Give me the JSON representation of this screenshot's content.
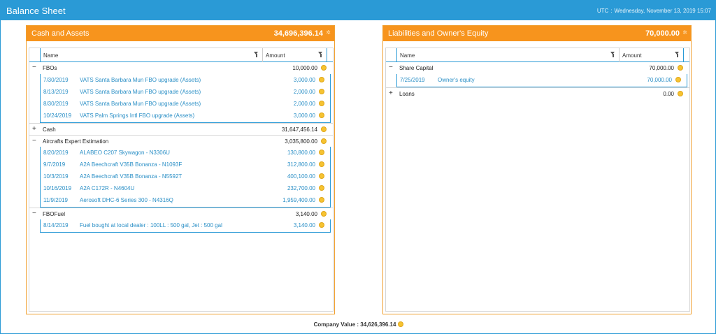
{
  "window": {
    "title": "Balance Sheet",
    "utc_label": "UTC",
    "utc_sep": ":",
    "datetime": "Wednesday, November 13, 2019 15:07"
  },
  "colors": {
    "titlebar": "#2a9ad6",
    "panel_header": "#f7941d",
    "link": "#2a8fc6",
    "coin": "#f6c331"
  },
  "left_panel": {
    "title": "Cash and Assets",
    "total": "34,696,396.14",
    "icon": "settings-icon",
    "columns": {
      "name": "Name",
      "amount": "Amount"
    },
    "groups": [
      {
        "expander": "−",
        "name": "FBOs",
        "amount": "10,000.00",
        "items": [
          {
            "date": "7/30/2019",
            "desc": "VATS Santa Barbara Mun FBO upgrade (Assets)",
            "amount": "3,000.00"
          },
          {
            "date": "8/13/2019",
            "desc": "VATS Santa Barbara Mun FBO upgrade (Assets)",
            "amount": "2,000.00"
          },
          {
            "date": "8/30/2019",
            "desc": "VATS Santa Barbara Mun FBO upgrade (Assets)",
            "amount": "2,000.00"
          },
          {
            "date": "10/24/2019",
            "desc": "VATS Palm Springs Intl FBO upgrade (Assets)",
            "amount": "3,000.00"
          }
        ]
      },
      {
        "expander": "+",
        "name": "Cash",
        "amount": "31,647,456.14",
        "items": []
      },
      {
        "expander": "−",
        "name": "Aircrafts Expert Estimation",
        "amount": "3,035,800.00",
        "items": [
          {
            "date": "8/20/2019",
            "desc": "ALABEO C207 Skywagon - N3306U",
            "amount": "130,800.00"
          },
          {
            "date": "9/7/2019",
            "desc": "A2A Beechcraft V35B Bonanza - N1093F",
            "amount": "312,800.00"
          },
          {
            "date": "10/3/2019",
            "desc": "A2A Beechcraft V35B Bonanza - N5592T",
            "amount": "400,100.00"
          },
          {
            "date": "10/16/2019",
            "desc": "A2A C172R - N4604U",
            "amount": "232,700.00"
          },
          {
            "date": "11/9/2019",
            "desc": "Aerosoft DHC-6 Series 300 - N4316Q",
            "amount": "1,959,400.00"
          }
        ]
      },
      {
        "expander": "−",
        "name": "FBOFuel",
        "amount": "3,140.00",
        "items": [
          {
            "date": "8/14/2019",
            "desc": "Fuel bought at local dealer : 100LL : 500 gal, Jet : 500 gal",
            "amount": "3,140.00"
          }
        ]
      }
    ]
  },
  "right_panel": {
    "title": "Liabilities and Owner's Equity",
    "total": "70,000.00",
    "icon": "settings-icon",
    "columns": {
      "name": "Name",
      "amount": "Amount"
    },
    "groups": [
      {
        "expander": "−",
        "name": "Share Capital",
        "amount": "70,000.00",
        "items": [
          {
            "date": "7/25/2019",
            "desc": "Owner's equity",
            "amount": "70,000.00"
          }
        ]
      },
      {
        "expander": "+",
        "name": "Loans",
        "amount": "0.00",
        "items": []
      }
    ]
  },
  "footer": {
    "label": "Company Value :",
    "value": "34,626,396.14"
  }
}
